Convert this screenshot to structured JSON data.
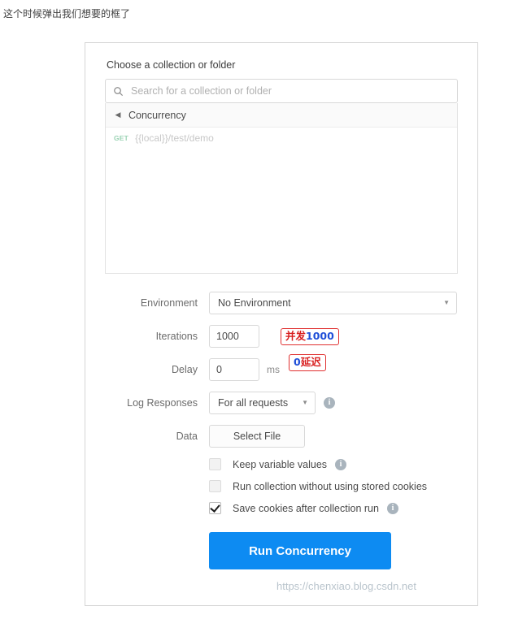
{
  "caption": "这个时候弹出我们想要的框了",
  "dialog": {
    "section_title": "Choose a collection or folder",
    "search": {
      "placeholder": "Search for a collection or folder",
      "value": "",
      "icon": "search-icon"
    },
    "collection": {
      "caret": "◀",
      "name": "Concurrency"
    },
    "requests": [
      {
        "method": "GET",
        "name": "{{local}}/test/demo"
      }
    ],
    "form": {
      "environment": {
        "label": "Environment",
        "value": "No Environment",
        "chevron": "▼"
      },
      "iterations": {
        "label": "Iterations",
        "value": "1000"
      },
      "delay": {
        "label": "Delay",
        "value": "0",
        "unit": "ms"
      },
      "log_responses": {
        "label": "Log Responses",
        "value": "For all requests",
        "chevron": "▼",
        "info": "i"
      },
      "data": {
        "label": "Data",
        "button_label": "Select File"
      },
      "checkboxes": [
        {
          "label": "Keep variable values",
          "checked": false,
          "info": "i"
        },
        {
          "label": "Run collection without using stored cookies",
          "checked": false,
          "info": ""
        },
        {
          "label": "Save cookies after collection run",
          "checked": true,
          "info": "i"
        }
      ],
      "run_button": "Run Concurrency"
    }
  },
  "annotations": [
    {
      "prefix": "并发",
      "number": "1000"
    },
    {
      "prefix": "",
      "number": "0",
      "suffix": "延迟"
    }
  ],
  "watermark": "https://chenxiao.blog.csdn.net",
  "colors": {
    "accent": "#0d8bf2",
    "annotation_red": "#d81f1f",
    "annotation_blue": "#1f4fd8",
    "method_get": "#9bd3b4"
  }
}
